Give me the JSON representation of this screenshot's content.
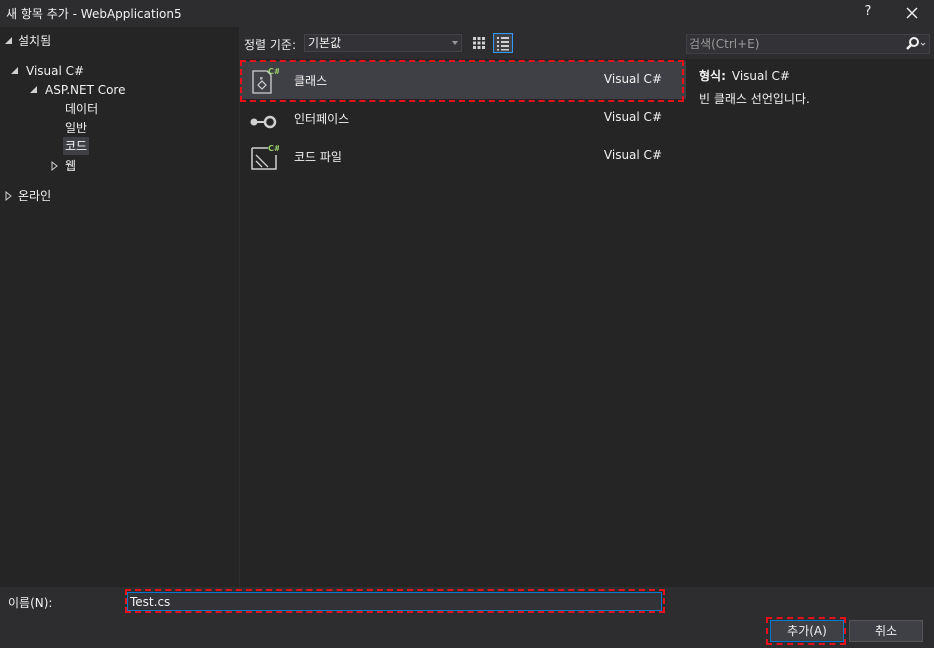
{
  "window": {
    "title": "새 항목 추가 - WebApplication5",
    "help_label": "?"
  },
  "tree": {
    "installed": "설치됨",
    "visual_csharp": "Visual C#",
    "aspnet_core": "ASP.NET Core",
    "data": "데이터",
    "general": "일반",
    "code": "코드",
    "web": "웹",
    "online": "온라인"
  },
  "sort": {
    "label": "정렬 기준:",
    "value": "기본값"
  },
  "templates": [
    {
      "name": "클래스",
      "type": "Visual C#",
      "icon": "class-icon"
    },
    {
      "name": "인터페이스",
      "type": "Visual C#",
      "icon": "interface-icon"
    },
    {
      "name": "코드 파일",
      "type": "Visual C#",
      "icon": "code-file-icon"
    }
  ],
  "search": {
    "placeholder": "검색(Ctrl+E)"
  },
  "details": {
    "type_key": "형식:",
    "type_value": "Visual C#",
    "description": "빈 클래스 선언입니다."
  },
  "bottom": {
    "name_label": "이름(N):",
    "name_value": "Test.cs",
    "add_button": "추가(A)",
    "cancel_button": "취소"
  },
  "colors": {
    "accent": "#007acc",
    "highlight": "#e8101a",
    "background": "#2d2d30",
    "panel": "#252526"
  }
}
